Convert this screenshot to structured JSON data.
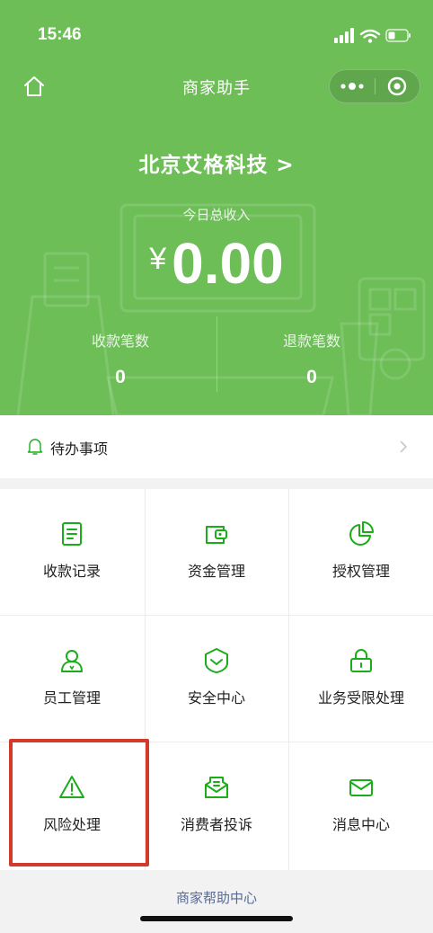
{
  "status_bar": {
    "time": "15:46"
  },
  "nav": {
    "title": "商家助手",
    "home_icon": "home-icon",
    "more_icon": "more-dots-icon",
    "close_icon": "target-close-icon"
  },
  "header": {
    "merchant_name": "北京艾格科技 >",
    "income_label": "今日总收入",
    "currency": "¥",
    "income_amount": "0.00",
    "stats": [
      {
        "label": "收款笔数",
        "value": "0"
      },
      {
        "label": "退款笔数",
        "value": "0"
      }
    ]
  },
  "todo": {
    "label": "待办事项",
    "icon": "bell-icon"
  },
  "grid": [
    {
      "label": "收款记录",
      "icon": "receipt-icon"
    },
    {
      "label": "资金管理",
      "icon": "wallet-icon"
    },
    {
      "label": "授权管理",
      "icon": "pie-chart-icon"
    },
    {
      "label": "员工管理",
      "icon": "person-icon"
    },
    {
      "label": "安全中心",
      "icon": "shield-icon"
    },
    {
      "label": "业务受限处理",
      "icon": "lock-icon"
    },
    {
      "label": "风险处理",
      "icon": "warning-icon"
    },
    {
      "label": "消费者投诉",
      "icon": "message-icon"
    },
    {
      "label": "消息中心",
      "icon": "envelope-icon"
    }
  ],
  "footer": {
    "help_label": "商家帮助中心"
  },
  "colors": {
    "brand_green": "#6dbe57",
    "icon_green": "#1aad19",
    "link_blue": "#576b95",
    "highlight_red": "#d23b2c"
  }
}
